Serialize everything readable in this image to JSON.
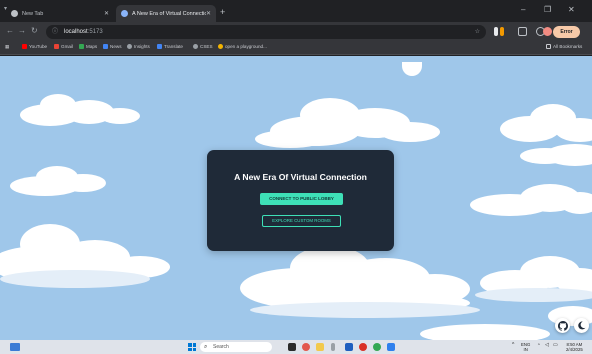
{
  "browser": {
    "tabs": [
      {
        "label": "New Tab",
        "icon": "chrome-icon",
        "active": false
      },
      {
        "label": "A New Era of Virtual Connectio",
        "icon": "tab-favicon",
        "active": true
      }
    ],
    "url_host": "localhost",
    "url_port": ":5173",
    "profile_label": "Error",
    "bookmarks": [
      {
        "label": "YouTube",
        "color": "#ff0000"
      },
      {
        "label": "Gmail",
        "color": "#ea4335"
      },
      {
        "label": "Maps",
        "color": "#34a853"
      },
      {
        "label": "News",
        "color": "#4285f4"
      },
      {
        "label": "Insights",
        "color": "#9aa0a6"
      },
      {
        "label": "Translate",
        "color": "#4285f4"
      },
      {
        "label": "CSES",
        "color": "#9aa0a6"
      },
      {
        "label": "open a playground...",
        "color": "#f4b400"
      }
    ],
    "all_bookmarks_label": "All Bookmarks"
  },
  "page": {
    "background_color": "#9fc7ea",
    "title": "A New Era Of Virtual Connection",
    "primary_button": "CONNECT TO PUBLIC LOBBY",
    "secondary_button": "EXPLORE CUSTOM ROOMS",
    "accent_color": "#3ee0b7",
    "card_color": "#1f2a38",
    "github_icon": "github-icon",
    "theme_icon": "moon-icon"
  },
  "taskbar": {
    "search_placeholder": "Search",
    "lang_top": "ENG",
    "lang_bottom": "IN",
    "time": "8:50 AM",
    "date": "2/4/2025"
  }
}
